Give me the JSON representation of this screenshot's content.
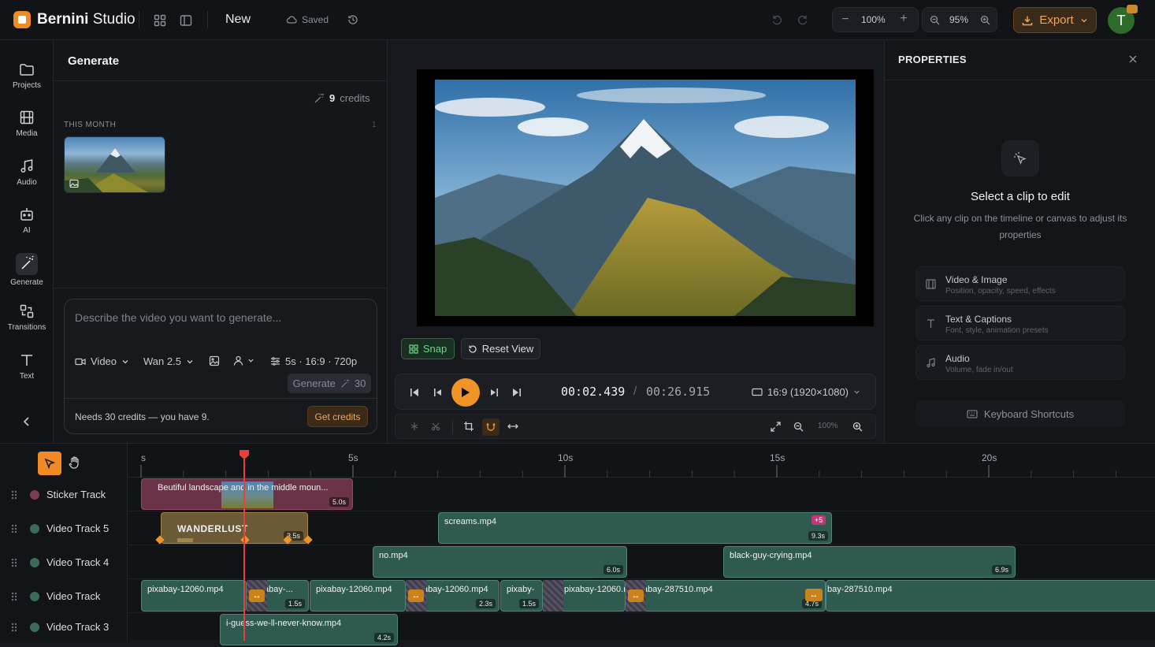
{
  "app": {
    "brand_bold": "Bernini",
    "brand_rest": " Studio",
    "project_name": "New",
    "save_status": "Saved"
  },
  "toolbar": {
    "zoom_canvas": "100%",
    "zoom_timeline": "95%",
    "export_label": "Export",
    "avatar_initial": "T"
  },
  "rail": {
    "items": [
      {
        "label": "Projects",
        "icon": "folder-icon"
      },
      {
        "label": "Media",
        "icon": "film-icon"
      },
      {
        "label": "Audio",
        "icon": "music-icon"
      },
      {
        "label": "AI",
        "icon": "robot-icon"
      },
      {
        "label": "Generate",
        "icon": "magic-wand-icon",
        "active": true
      },
      {
        "label": "Transitions",
        "icon": "transitions-icon"
      },
      {
        "label": "Text",
        "icon": "text-icon"
      }
    ]
  },
  "generate": {
    "title": "Generate",
    "credits_value": "9",
    "credits_label": "credits",
    "section_label": "THIS MONTH",
    "section_count": "1",
    "prompt_placeholder": "Describe the video you want to generate...",
    "type_label": "Video",
    "model_label": "Wan 2.5",
    "settings_label": "5s · 16:9 · 720p",
    "generate_label": "Generate",
    "generate_cost": "30",
    "needs_text": "Needs 30 credits — you have 9.",
    "get_credits_label": "Get credits"
  },
  "preview": {
    "snap_label": "Snap",
    "reset_label": "Reset View",
    "time_current": "00:02.439",
    "time_sep": "/",
    "time_total": "00:26.915",
    "aspect_label": "16:9 (1920×1080)",
    "zoom_label": "100%"
  },
  "properties": {
    "title": "PROPERTIES",
    "empty_title": "Select a clip to edit",
    "empty_desc": "Click any clip on the timeline or canvas to adjust its properties",
    "cards": [
      {
        "title": "Video & Image",
        "sub": "Position, opacity, speed, effects",
        "icon": "film-icon"
      },
      {
        "title": "Text & Captions",
        "sub": "Font, style, animation presets",
        "icon": "text-icon"
      },
      {
        "title": "Audio",
        "sub": "Volume, fade in/out",
        "icon": "music-icon"
      }
    ],
    "shortcuts_label": "Keyboard Shortcuts"
  },
  "ruler": {
    "labels": [
      "s",
      "5s",
      "10s",
      "15s",
      "20s"
    ]
  },
  "tracks": [
    {
      "name": "Sticker Track",
      "color": "#7a3d4f"
    },
    {
      "name": "Video Track 5",
      "color": "#3d6b5a"
    },
    {
      "name": "Video Track 4",
      "color": "#3d6b5a"
    },
    {
      "name": "Video Track",
      "color": "#3d6b5a"
    },
    {
      "name": "Video Track 3",
      "color": "#3d6b5a"
    }
  ],
  "clips": {
    "sticker": {
      "label": "Beutiful landscape and in the middle moun...",
      "dur": "5.0s"
    },
    "wanderlust": {
      "label": "WANDERLUST",
      "dur": "3.5s"
    },
    "screams": {
      "label": "screams.mp4",
      "dur": "9.3s",
      "badge": "+5"
    },
    "no": {
      "label": "no.mp4",
      "dur": "6.0s"
    },
    "black_guy": {
      "label": "black-guy-crying.mp4",
      "dur": "6.9s"
    },
    "vt": [
      {
        "label": "pixabay-12060.mp4",
        "dur": ""
      },
      {
        "label": "pixabay-...",
        "dur": "1.5s"
      },
      {
        "label": "pixabay-12060.mp4",
        "dur": ""
      },
      {
        "label": "pixabay-12060.mp4",
        "dur": "2.3s"
      },
      {
        "label": "pixaby-",
        "dur": "1.5s"
      },
      {
        "label": "pixabay-12060.mp",
        "dur": ""
      },
      {
        "label": "pixabay-287510.mp4",
        "dur": "4.7s"
      },
      {
        "label": "bay-287510.mp4",
        "dur": ""
      }
    ],
    "vt3": {
      "label": "i-guess-we-ll-never-know.mp4",
      "dur": "4.2s"
    }
  }
}
